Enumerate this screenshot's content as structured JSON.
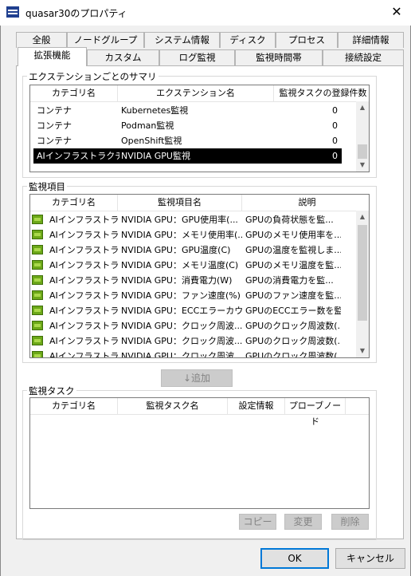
{
  "window": {
    "title": "quasar30のプロパティ",
    "close_glyph": "✕"
  },
  "tabs_row1": [
    "全般",
    "ノードグループ",
    "システム情報",
    "ディスク",
    "プロセス",
    "詳細情報"
  ],
  "tabs_row2": [
    "拡張機能",
    "カスタム",
    "ログ監視",
    "監視時間帯",
    "接続設定"
  ],
  "active_tab": "拡張機能",
  "summary": {
    "group_label": "エクステンションごとのサマリ",
    "headers": [
      "カテゴリ名",
      "エクステンション名",
      "監視タスクの登録件数"
    ],
    "rows": [
      {
        "category": "コンテナ",
        "extension": "Kubernetes監視",
        "count": "0"
      },
      {
        "category": "コンテナ",
        "extension": "Podman監視",
        "count": "0"
      },
      {
        "category": "コンテナ",
        "extension": "OpenShift監視",
        "count": "0"
      },
      {
        "category": "AIインフラストラクチ...",
        "extension": "NVIDIA GPU監視",
        "count": "0",
        "selected": true
      }
    ]
  },
  "items": {
    "group_label": "監視項目",
    "headers": [
      "カテゴリ名",
      "監視項目名",
      "説明"
    ],
    "rows": [
      {
        "category": "AIインフラストラ...",
        "name": "NVIDIA GPU：GPU使用率(...",
        "description": "GPUの負荷状態を監..."
      },
      {
        "category": "AIインフラストラ...",
        "name": "NVIDIA GPU：メモリ使用率(...",
        "description": "GPUのメモリ使用率を..."
      },
      {
        "category": "AIインフラストラ...",
        "name": "NVIDIA GPU：GPU温度(C)",
        "description": "GPUの温度を監視しま..."
      },
      {
        "category": "AIインフラストラ...",
        "name": "NVIDIA GPU：メモリ温度(C)",
        "description": "GPUのメモリ温度を監..."
      },
      {
        "category": "AIインフラストラ...",
        "name": "NVIDIA GPU：消費電力(W)",
        "description": "GPUの消費電力を監..."
      },
      {
        "category": "AIインフラストラ...",
        "name": "NVIDIA GPU：ファン速度(%)",
        "description": "GPUのファン速度を監..."
      },
      {
        "category": "AIインフラストラ...",
        "name": "NVIDIA GPU：ECCエラーカウ...",
        "description": "GPUのECCエラー数を監..."
      },
      {
        "category": "AIインフラストラ...",
        "name": "NVIDIA GPU：クロック周波...",
        "description": "GPUのクロック周波数(..."
      },
      {
        "category": "AIインフラストラ...",
        "name": "NVIDIA GPU：クロック周波...",
        "description": "GPUのクロック周波数(..."
      },
      {
        "category": "AIインフラストラ...",
        "name": "NVIDIA GPU：クロック周波...",
        "description": "GPUのクロック周波数(..."
      }
    ]
  },
  "add_button": "↓追加",
  "tasks": {
    "group_label": "監視タスク",
    "headers": [
      "カテゴリ名",
      "監視タスク名",
      "設定情報",
      "プローブノード"
    ],
    "buttons": {
      "copy": "コピー",
      "edit": "変更",
      "delete": "削除"
    }
  },
  "footer": {
    "ok": "OK",
    "cancel": "キャンセル"
  },
  "colors": {
    "selection": "#000000",
    "gpu_icon": "#6ca818",
    "default_button_border": "#0078d7"
  }
}
